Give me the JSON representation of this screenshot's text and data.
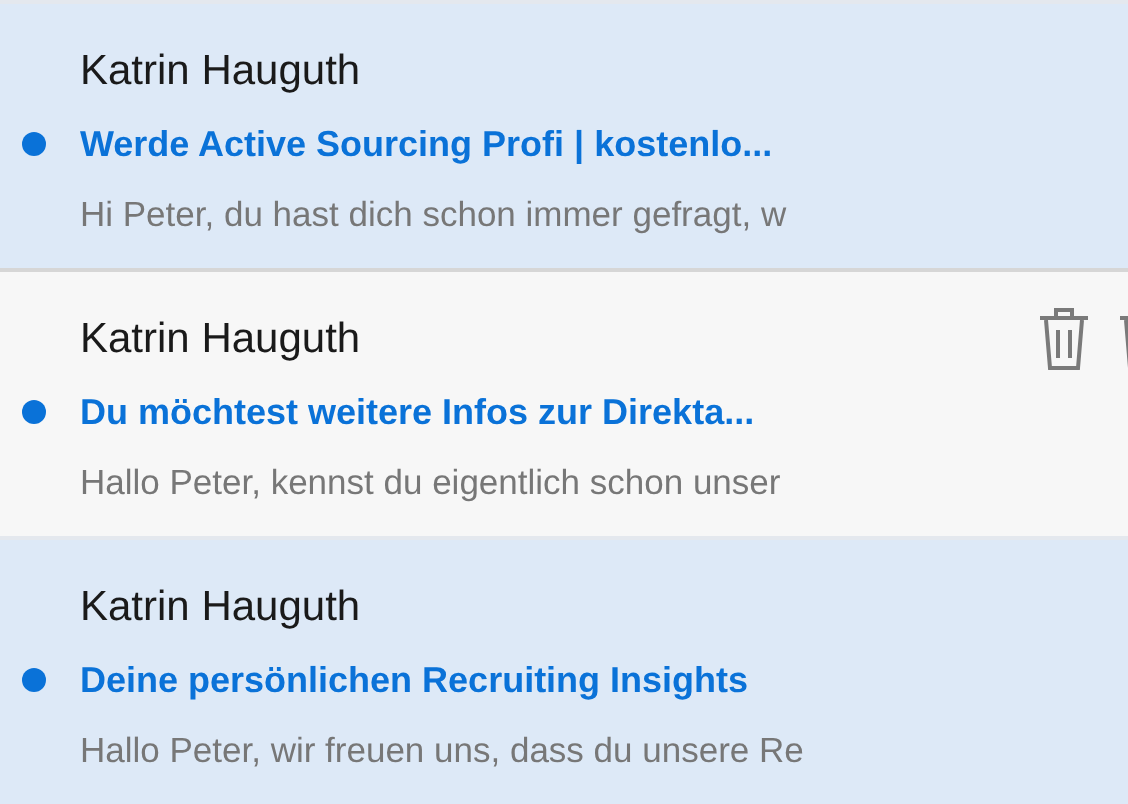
{
  "messages": [
    {
      "sender": "Katrin Hauguth",
      "subject": "Werde Active Sourcing Profi | kostenlo...",
      "preview": "Hi Peter, du hast dich schon immer gefragt, w",
      "unread": true,
      "selected": true,
      "hovered": false
    },
    {
      "sender": "Katrin Hauguth",
      "subject": "Du möchtest weitere Infos zur Direkta...",
      "preview": "Hallo Peter, kennst du eigentlich schon unser",
      "unread": true,
      "selected": false,
      "hovered": true
    },
    {
      "sender": "Katrin Hauguth",
      "subject": "Deine persönlichen Recruiting Insights",
      "preview": "Hallo Peter, wir freuen uns, dass du unsere Re",
      "unread": true,
      "selected": true,
      "hovered": false
    }
  ]
}
